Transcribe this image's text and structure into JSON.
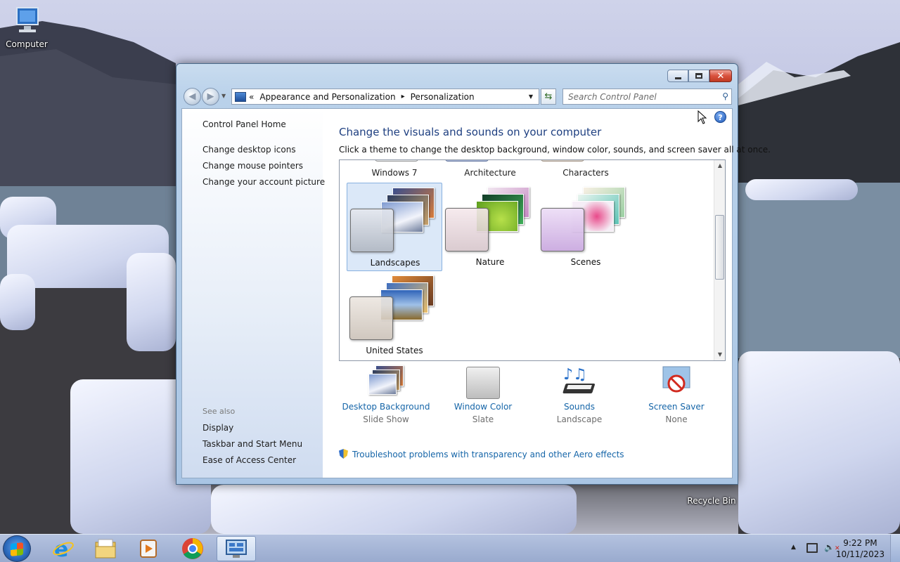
{
  "desktop": {
    "icons": [
      {
        "label": "Computer"
      },
      {
        "label": "Recycle Bin"
      }
    ]
  },
  "window": {
    "address": {
      "chevron": "«",
      "crumbs": [
        "Appearance and Personalization",
        "Personalization"
      ],
      "separator": "▸"
    },
    "search": {
      "placeholder": "Search Control Panel"
    },
    "help_label": "?",
    "left_pane": {
      "home": "Control Panel Home",
      "tasks": [
        "Change desktop icons",
        "Change mouse pointers",
        "Change your account picture"
      ],
      "see_also_heading": "See also",
      "see_also": [
        "Display",
        "Taskbar and Start Menu",
        "Ease of Access Center"
      ]
    },
    "main": {
      "title": "Change the visuals and sounds on your computer",
      "subtitle": "Click a theme to change the desktop background, window color, sounds, and screen saver all at once.",
      "themes_top_row": [
        "Windows 7",
        "Architecture",
        "Characters"
      ],
      "themes": [
        {
          "name": "Landscapes",
          "selected": true
        },
        {
          "name": "Nature",
          "selected": false
        },
        {
          "name": "Scenes",
          "selected": false
        },
        {
          "name": "United States",
          "selected": false
        }
      ],
      "settings": [
        {
          "label": "Desktop Background",
          "value": "Slide Show",
          "icon": "photo-stack-icon"
        },
        {
          "label": "Window Color",
          "value": "Slate",
          "icon": "color-swatch-icon"
        },
        {
          "label": "Sounds",
          "value": "Landscape",
          "icon": "music-notes-icon"
        },
        {
          "label": "Screen Saver",
          "value": "None",
          "icon": "screen-saver-none-icon"
        }
      ],
      "troubleshoot_link": "Troubleshoot problems with transparency and other Aero effects"
    }
  },
  "taskbar": {
    "pinned": [
      "internet-explorer-icon",
      "file-explorer-icon",
      "media-player-icon",
      "chrome-icon",
      "control-panel-icon"
    ],
    "active": "control-panel-icon",
    "clock": {
      "time": "9:22 PM",
      "date": "10/11/2023"
    },
    "tray_expand": "▲"
  },
  "colors": {
    "link": "#1565a8",
    "title": "#1e3f80",
    "selection": "#dbe8f8"
  }
}
